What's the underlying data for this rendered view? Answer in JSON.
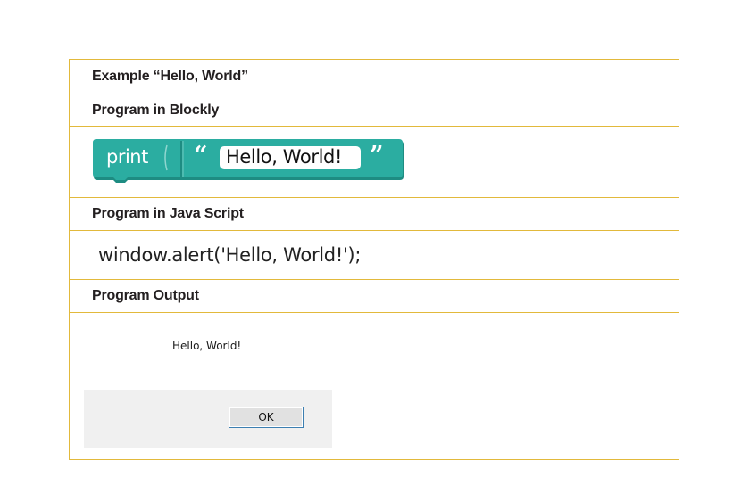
{
  "table": {
    "rows": [
      {
        "heading": "Example “Hello, World”"
      },
      {
        "heading": "Program in Blockly"
      },
      {
        "heading": "Program in Java Script"
      },
      {
        "heading": "Program Output"
      }
    ]
  },
  "blockly": {
    "block_label": "print",
    "open_quote": "“",
    "string_value": "Hello, World!",
    "close_quote": "”",
    "block_color": "#2bada1",
    "block_shadow_color": "#1e8c82"
  },
  "javascript": {
    "code": "window.alert('Hello, World!');"
  },
  "output": {
    "message": "Hello, World!",
    "ok_label": "OK"
  },
  "colors": {
    "border": "#e2b93b",
    "heading_text": "#231f20"
  }
}
